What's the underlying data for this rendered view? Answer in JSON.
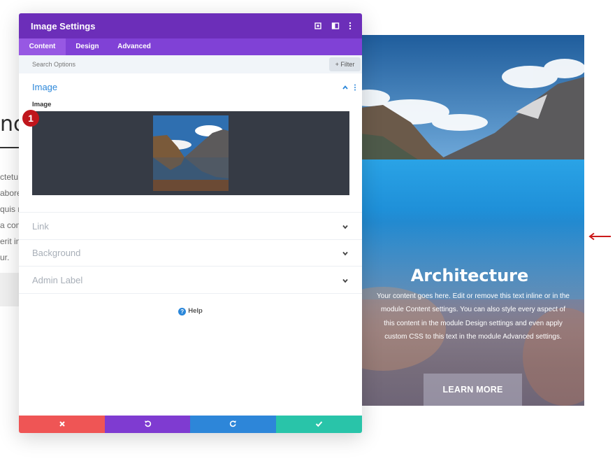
{
  "background_page": {
    "heading_fragment": "nc",
    "text_fragments": [
      "ctetu",
      "abore",
      "quis n",
      "a com",
      "erit in",
      "ur."
    ]
  },
  "card": {
    "title": "Architecture",
    "body": "Your content goes here. Edit or remove this text inline or in the module Content settings. You can also style every aspect of this content in the module Design settings and even apply custom CSS to this text in the module Advanced settings.",
    "button_label": "LEARN MORE"
  },
  "modal": {
    "title": "Image Settings",
    "tabs": [
      {
        "label": "Content",
        "active": true
      },
      {
        "label": "Design",
        "active": false
      },
      {
        "label": "Advanced",
        "active": false
      }
    ],
    "search": {
      "placeholder": "Search Options"
    },
    "filter_label": "Filter",
    "image_section": {
      "title": "Image",
      "field_label": "Image",
      "badge_number": "1"
    },
    "collapsed_sections": [
      {
        "label": "Link"
      },
      {
        "label": "Background"
      },
      {
        "label": "Admin Label"
      }
    ],
    "help_label": "Help",
    "footer": {
      "cancel_icon": "x-icon",
      "undo_icon": "undo-icon",
      "redo_icon": "redo-icon",
      "save_icon": "check-icon"
    }
  },
  "colors": {
    "header_purple": "#6c2eb9",
    "tabs_purple": "#8041d6",
    "accent_blue": "#2b87da",
    "cancel_red": "#ef5555",
    "undo_purple": "#7f3bd1",
    "redo_blue": "#2d86d9",
    "save_teal": "#29c4a9",
    "badge_red": "#c0161c",
    "arrow_red": "#cc1b1b"
  }
}
